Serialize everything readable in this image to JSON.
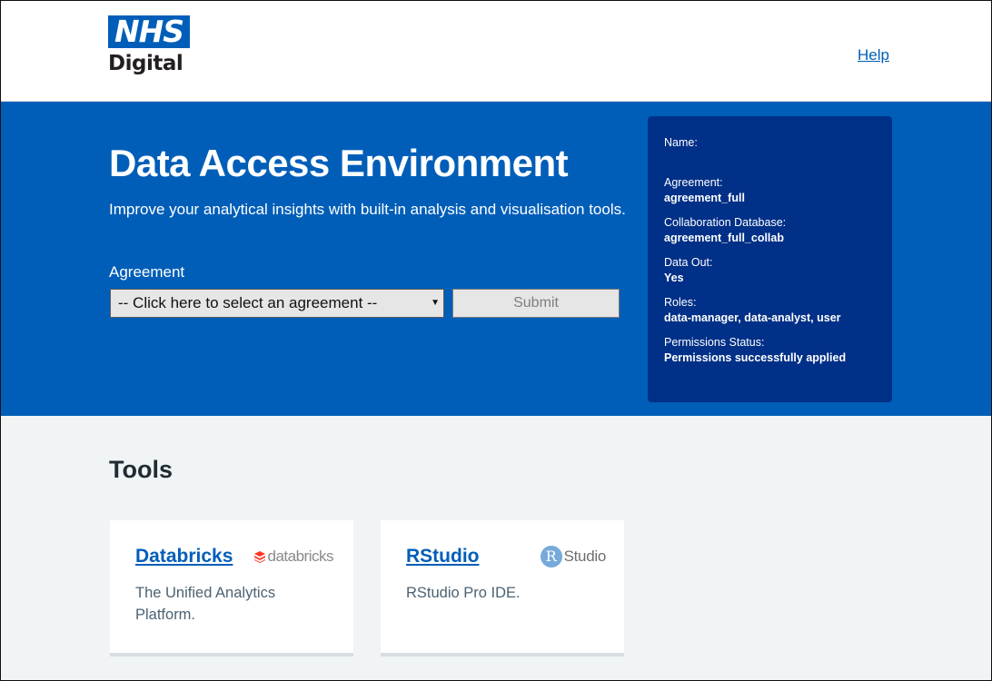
{
  "header": {
    "logo_top": "NHS",
    "logo_bottom": "Digital",
    "help_label": "Help"
  },
  "hero": {
    "title": "Data Access Environment",
    "description": "Improve your analytical insights with built-in analysis and visualisation tools.",
    "agreement_label": "Agreement",
    "agreement_select_value": "-- Click here to select an agreement --",
    "submit_label": "Submit"
  },
  "info_panel": {
    "items": [
      {
        "label": "Name:",
        "value": ""
      },
      {
        "label": "Agreement:",
        "value": "agreement_full"
      },
      {
        "label": "Collaboration Database:",
        "value": "agreement_full_collab"
      },
      {
        "label": "Data Out:",
        "value": "Yes"
      },
      {
        "label": "Roles:",
        "value": "data-manager, data-analyst, user"
      },
      {
        "label": "Permissions Status:",
        "value": "Permissions successfully applied"
      }
    ]
  },
  "tools": {
    "title": "Tools",
    "cards": [
      {
        "name": "Databricks",
        "description": "The Unified Analytics Platform.",
        "logo_text": "databricks",
        "logo_icon": "databricks-stack-icon"
      },
      {
        "name": "RStudio",
        "description": "RStudio Pro IDE.",
        "logo_text": "Studio",
        "logo_letter": "R",
        "logo_icon": "rstudio-r-icon"
      }
    ]
  },
  "colors": {
    "nhs_blue": "#005eb8",
    "nhs_dark_blue": "#003087",
    "page_grey": "#f0f4f5",
    "databricks_red": "#ff3621",
    "rstudio_blue": "#75aadb"
  }
}
